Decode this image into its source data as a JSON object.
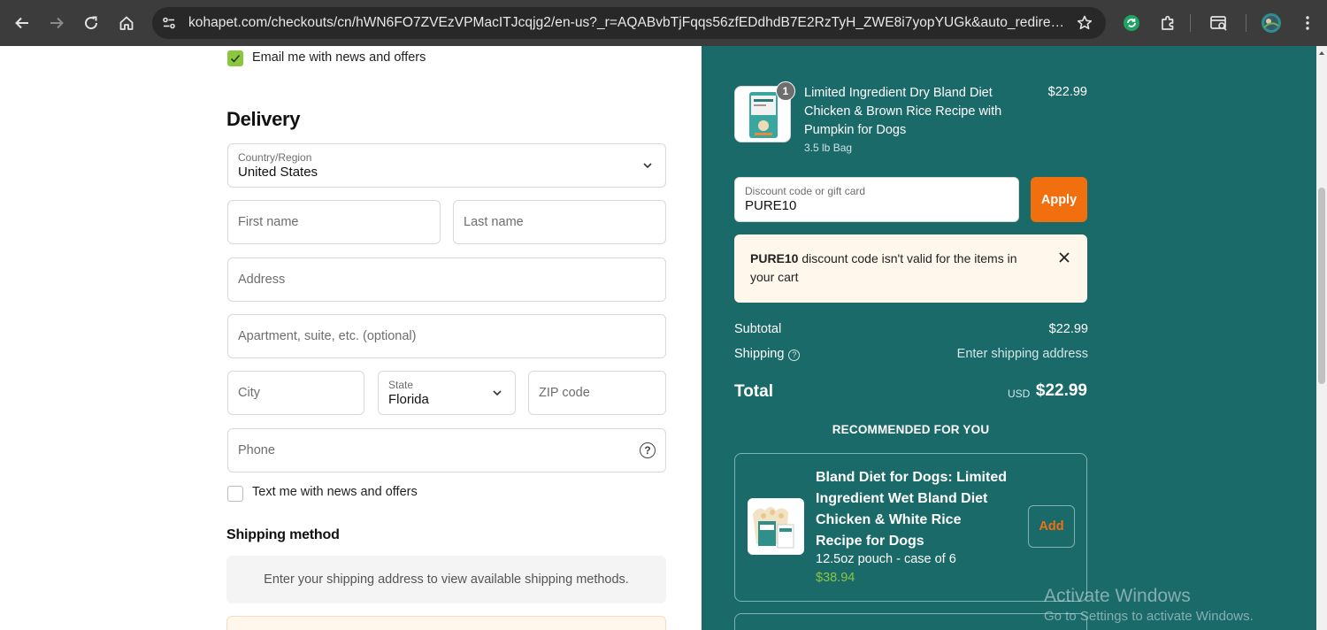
{
  "browser": {
    "url": "kohapet.com/checkouts/cn/hWN6FO7ZVEzVPMacITJcqjg2/en-us?_r=AQABvbTjFqqs56zfEDdhdB7E2RzTyH_ZWE8i7yopYUGk&auto_redirect=fals..."
  },
  "form": {
    "email_offers_label": "Email me with news and offers",
    "delivery_heading": "Delivery",
    "country": {
      "label": "Country/Region",
      "value": "United States"
    },
    "first_name_placeholder": "First name",
    "last_name_placeholder": "Last name",
    "address_placeholder": "Address",
    "apartment_placeholder": "Apartment, suite, etc. (optional)",
    "city_placeholder": "City",
    "state": {
      "label": "State",
      "value": "Florida"
    },
    "zip_placeholder": "ZIP code",
    "phone_placeholder": "Phone",
    "text_offers_label": "Text me with news and offers",
    "shipping_method_heading": "Shipping method",
    "shipping_method_message": "Enter your shipping address to view available shipping methods."
  },
  "summary": {
    "product": {
      "quantity": "1",
      "name": "Limited Ingredient Dry Bland Diet Chicken & Brown Rice Recipe with Pumpkin for Dogs",
      "variant": "3.5 lb Bag",
      "price": "$22.99"
    },
    "discount": {
      "label": "Discount code or gift card",
      "value": "PURE10",
      "apply_label": "Apply"
    },
    "error": {
      "code": "PURE10",
      "message": " discount code isn't valid for the items in your cart"
    },
    "subtotal_label": "Subtotal",
    "subtotal_value": "$22.99",
    "shipping_label": "Shipping",
    "shipping_value": "Enter shipping address",
    "total_label": "Total",
    "total_currency": "USD",
    "total_value": "$22.99",
    "recommended_title": "RECOMMENDED FOR YOU",
    "recommended": [
      {
        "name": "Bland Diet for Dogs: Limited Ingredient Wet Bland Diet Chicken & White Rice Recipe for Dogs",
        "variant": "12.5oz pouch - case of 6",
        "price": "$38.94",
        "add_label": "Add"
      }
    ]
  },
  "watermark": {
    "line1": "Activate Windows",
    "line2": "Go to Settings to activate Windows."
  },
  "colors": {
    "summary_bg": "#1a6a6a",
    "accent_orange": "#f26f0f",
    "accent_green": "#8cc63f",
    "error_bg": "#fff6ec"
  }
}
